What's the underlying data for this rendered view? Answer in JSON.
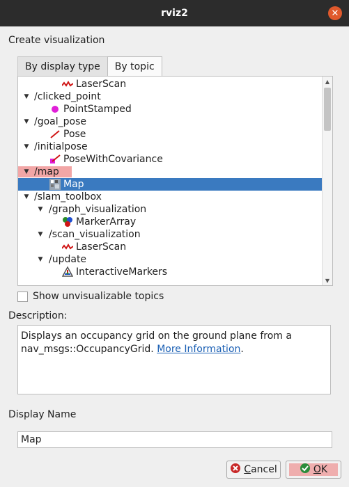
{
  "window": {
    "title": "rviz2"
  },
  "section": {
    "create_label": "Create visualization",
    "description_label": "Description:",
    "display_name_label": "Display Name"
  },
  "tabs": [
    "By display type",
    "By topic"
  ],
  "active_tab": "By topic",
  "tree": [
    {
      "label": "LaserScan",
      "icon": "laserscan-icon",
      "expanded": null,
      "selected": false
    },
    {
      "label": "/clicked_point",
      "icon": null,
      "expanded": true
    },
    {
      "label": "PointStamped",
      "icon": "point-stamped-icon",
      "expanded": null
    },
    {
      "label": "/goal_pose",
      "icon": null,
      "expanded": true
    },
    {
      "label": "Pose",
      "icon": "pose-icon",
      "expanded": null
    },
    {
      "label": "/initialpose",
      "icon": null,
      "expanded": true
    },
    {
      "label": "PoseWithCovariance",
      "icon": "pose-with-covariance-icon",
      "expanded": null
    },
    {
      "label": "/map",
      "icon": null,
      "expanded": true,
      "highlighted": true
    },
    {
      "label": "Map",
      "icon": "map-icon",
      "expanded": null,
      "selected": true
    },
    {
      "label": "/slam_toolbox",
      "icon": null,
      "expanded": true
    },
    {
      "label": "/graph_visualization",
      "icon": null,
      "expanded": true
    },
    {
      "label": "MarkerArray",
      "icon": "marker-array-icon",
      "expanded": null
    },
    {
      "label": "/scan_visualization",
      "icon": null,
      "expanded": true
    },
    {
      "label": "LaserScan",
      "icon": "laserscan-icon",
      "expanded": null
    },
    {
      "label": "/update",
      "icon": null,
      "expanded": true
    },
    {
      "label": "InteractiveMarkers",
      "icon": "interactive-markers-icon",
      "expanded": null
    }
  ],
  "show_unvisualizable": {
    "label": "Show unvisualizable topics",
    "checked": false
  },
  "description": {
    "text_line1": "Displays an occupancy grid on the ground plane from a",
    "text_line2": "nav_msgs::OccupancyGrid.",
    "link": "More Information",
    "tail": "."
  },
  "display_name": {
    "value": "Map"
  },
  "buttons": {
    "cancel_first": "C",
    "cancel_rest": "ancel",
    "ok_first": "O",
    "ok_rest": "K"
  },
  "colors": {
    "selection": "#3a7ac0",
    "highlight": "#ec8080",
    "titlebar": "#2c2c2c",
    "close": "#e0592c"
  }
}
